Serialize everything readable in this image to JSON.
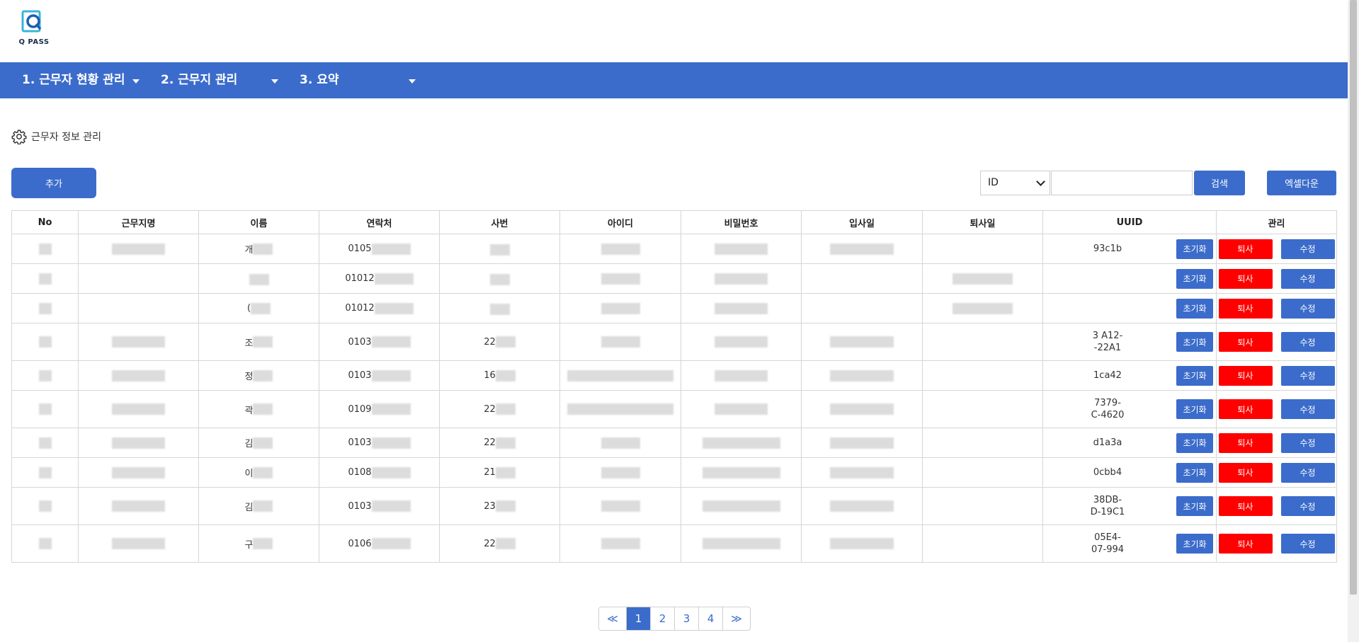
{
  "logo": {
    "text": "Q PASS"
  },
  "nav": {
    "items": [
      {
        "label": "1. 근무자 현황 관리"
      },
      {
        "label": "2. 근무지 관리"
      },
      {
        "label": "3. 요약"
      }
    ]
  },
  "section": {
    "title": "근무자 정보 관리",
    "icon": "gear-icon"
  },
  "toolbar": {
    "add_label": "추가",
    "search_field": "ID",
    "search_placeholder": "",
    "search_label": "검색",
    "excel_label": "엑셀다운"
  },
  "table": {
    "headers": [
      "No",
      "근무지명",
      "이름",
      "연락처",
      "사번",
      "아이디",
      "비밀번호",
      "입사일",
      "퇴사일",
      "UUID",
      "관리"
    ],
    "rows": [
      {
        "name": "개",
        "phone": "0105",
        "emp": "",
        "uuid": "93c1b"
      },
      {
        "name": "",
        "phone": "01012",
        "emp": "",
        "uuid": ""
      },
      {
        "name": "(",
        "phone": "01012",
        "emp": "",
        "uuid": ""
      },
      {
        "name": "조",
        "phone": "0103",
        "emp": "22",
        "uuid": "3 A12-\n -22A1"
      },
      {
        "name": "정",
        "phone": "0103",
        "emp": "16",
        "uuid": "1ca42"
      },
      {
        "name": "곽",
        "phone": "0109",
        "emp": "22",
        "uuid": "7379-\nC-4620"
      },
      {
        "name": "김",
        "phone": "0103",
        "emp": "22",
        "uuid": "d1a3a"
      },
      {
        "name": "이",
        "phone": "0108",
        "emp": "21",
        "uuid": "0cbb4"
      },
      {
        "name": "김",
        "phone": "0103",
        "emp": "23",
        "uuid": "38DB-\nD-19C1"
      },
      {
        "name": "구",
        "phone": "0106",
        "emp": "22",
        "uuid": "05E4-\n07-994"
      }
    ],
    "btn_reset": "초기화",
    "btn_quit": "퇴사",
    "btn_edit": "수정"
  },
  "pagination": {
    "prev": "≪",
    "pages": [
      "1",
      "2",
      "3",
      "4"
    ],
    "next": "≫",
    "current": "1"
  },
  "colors": {
    "primary": "#3b6ccb",
    "danger": "#ff0000"
  }
}
